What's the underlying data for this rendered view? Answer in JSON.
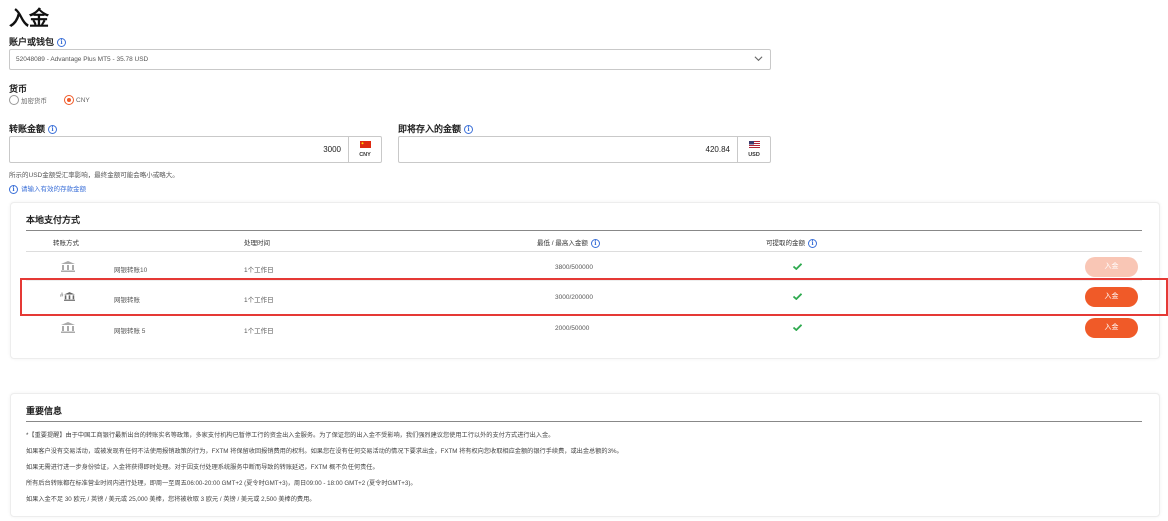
{
  "page": {
    "title": "入金"
  },
  "account": {
    "label": "账户或钱包",
    "selected": "52048089 - Advantage Plus MT5 - 35.78 USD"
  },
  "currency": {
    "label": "货币",
    "options": [
      {
        "label": "加密货币",
        "selected": false
      },
      {
        "label": "CNY",
        "selected": true
      }
    ]
  },
  "transfer_amount": {
    "label": "转账金额",
    "value": "3000",
    "currency": "CNY"
  },
  "deposit_amount": {
    "label": "即将存入的金额",
    "value": "420.84",
    "currency": "USD"
  },
  "notes": {
    "rate": "所示的USD金额受汇率影响，最终金额可能会略小或略大。",
    "hint": "请输入有效的存款金额"
  },
  "local_payment": {
    "title": "本地支付方式",
    "headers": {
      "method": "转账方式",
      "time": "处理时间",
      "limits": "最低 / 最高入金额",
      "withdrawable": "可提取的金额"
    },
    "rows": [
      {
        "name": "网银转账10",
        "time": "1个工作日",
        "limits": "3800/500000",
        "button": "入金",
        "disabled": true
      },
      {
        "name": "网银转账",
        "time": "1个工作日",
        "limits": "3000/200000",
        "button": "入金",
        "disabled": false
      },
      {
        "name": "网银转账 5",
        "time": "1个工作日",
        "limits": "2000/50000",
        "button": "入金",
        "disabled": false
      }
    ]
  },
  "important": {
    "title": "重要信息",
    "lines": [
      "*【重要提醒】由于中国工商银行最新出台的转账实名等政策，多家支付机构已暂停工行的资金出入金服务。为了保证您的出入金不受影响，我们强烈建议您使用工行以外的支付方式进行出入金。",
      "如果客户没有交易活动，或被发现有任何不法使用报销政策的行为，FXTM 将保留收回报销费用的权利。如果您在没有任何交易活动的情况下要求出金，FXTM 将有权向您收取相应金额的银行手续费，或出金总额的3%。",
      "如果无需进行进一步身份验证，入金将获得即时处理。对于因支付处理系统服务中断而导致的转账延迟，FXTM 概不负任何责任。",
      "所有后台转账都在标准营业时间内进行处理，即周一至周五06:00-20:00 GMT+2 (夏令时GMT+3)，周日09:00 - 18:00 GMT+2 (夏令时GMT+3)。",
      "如果入金不足 30 欧元 / 英镑 / 美元或 25,000 美棒，您将被收取 3 欧元 / 英镑 / 美元或 2,500 美棒的费用。"
    ]
  },
  "colors": {
    "accent": "#f05a28",
    "accent_disabled": "#f9c6b5",
    "check": "#2eaa4f",
    "highlight": "#e53935",
    "link": "#3a6fd8"
  }
}
